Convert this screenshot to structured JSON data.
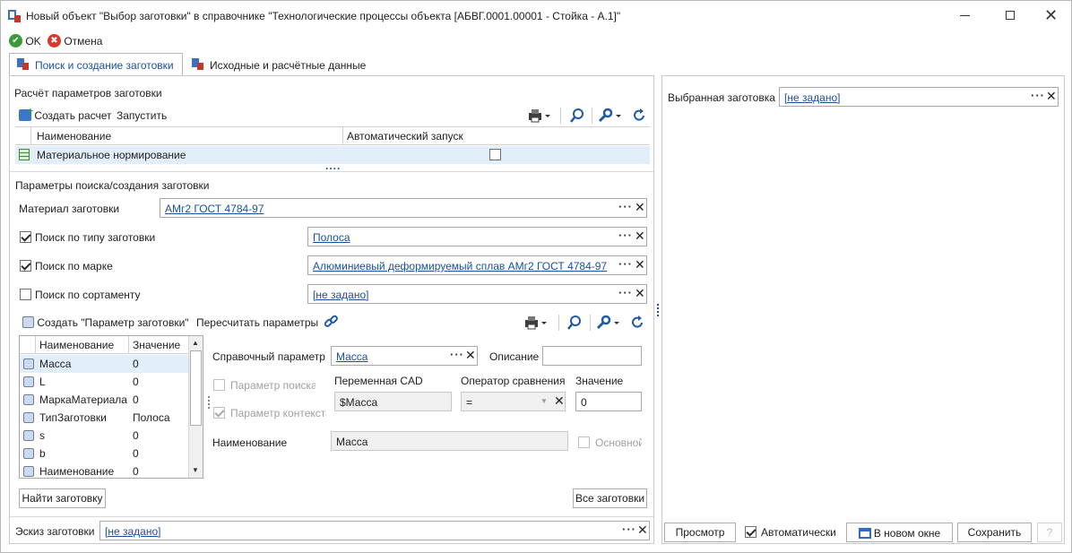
{
  "window": {
    "title": "Новый объект \"Выбор заготовки\" в справочнике \"Технологические процессы объекта [АБВГ.0001.00001 - Стойка - А.1]\""
  },
  "toolbar": {
    "ok": "OK",
    "cancel": "Отмена"
  },
  "tabs": [
    {
      "label": "Поиск и создание заготовки"
    },
    {
      "label": "Исходные и расчётные данные"
    }
  ],
  "calc": {
    "section_title": "Расчёт параметров заготовки",
    "create_label": "Создать расчет",
    "run_label": "Запустить",
    "columns": [
      "Наименование",
      "Автоматический запуск"
    ],
    "rows": [
      {
        "name": "Материальное нормирование",
        "auto": false
      }
    ],
    "splitter": "...."
  },
  "search": {
    "section_title": "Параметры поиска/создания заготовки",
    "material_label": "Материал заготовки",
    "material_value": "АМг2 ГОСТ 4784-97",
    "type_label": "Поиск по типу заготовки",
    "type_value": "Полоса",
    "mark_label": "Поиск по марке",
    "mark_value": "Алюминиевый деформируемый сплав АМг2 ГОСТ 4784-97",
    "sort_label": "Поиск по сортаменту",
    "sort_value": "[не задано]"
  },
  "params": {
    "create_label": "Создать \"Параметр заготовки\"",
    "recalc_label": "Пересчитать параметры",
    "columns": [
      "Наименование",
      "Значение"
    ],
    "rows": [
      {
        "name": "Масса",
        "value": "0"
      },
      {
        "name": "L",
        "value": "0"
      },
      {
        "name": "МаркаМатериала",
        "value": "0"
      },
      {
        "name": "ТипЗаготовки",
        "value": "Полоса"
      },
      {
        "name": "s",
        "value": "0"
      },
      {
        "name": "b",
        "value": "0"
      },
      {
        "name": "Наименование",
        "value": "0"
      }
    ]
  },
  "detail": {
    "ref_label": "Справочный параметр",
    "ref_value": "Масса",
    "desc_label": "Описание",
    "search_param": "Параметр поиска",
    "context_param": "Параметр контекста",
    "cad_label": "Переменная CAD",
    "cad_value": "$Масса",
    "op_label": "Оператор сравнения",
    "op_value": "=",
    "val_label": "Значение",
    "val_value": "0",
    "name_label": "Наименование",
    "name_value": "Масса",
    "main_label": "Основной"
  },
  "buttons": {
    "find": "Найти заготовку",
    "all": "Все заготовки"
  },
  "sketch": {
    "label": "Эскиз заготовки",
    "value": "[не задано]"
  },
  "right": {
    "selected_label": "Выбранная заготовка",
    "selected_value": "[не задано]",
    "preview": "Просмотр",
    "auto": "Автоматически",
    "new_window": "В новом окне",
    "save": "Сохранить",
    "help": "?"
  }
}
